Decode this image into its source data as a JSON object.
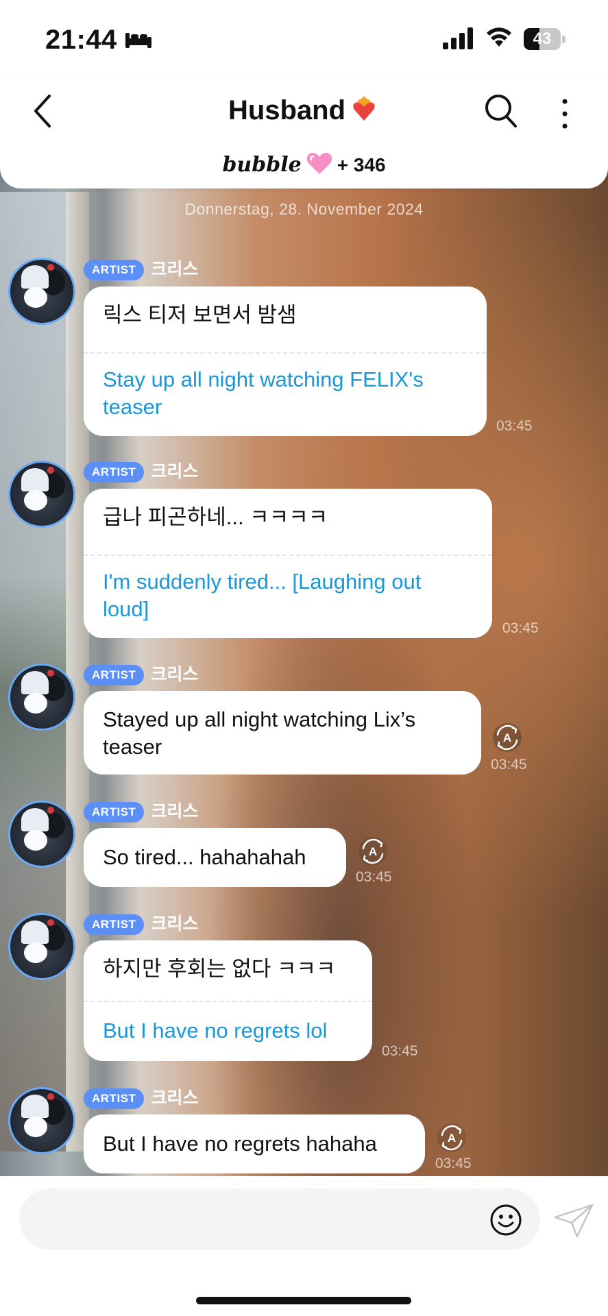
{
  "status_bar": {
    "time": "21:44",
    "battery": "43",
    "battery_level_percent": 43
  },
  "header": {
    "title": "Husband",
    "title_emoji": "heart-on-fire",
    "brand": "bubble",
    "count": "+ 346"
  },
  "chat": {
    "date": "Donnerstag, 28. November 2024",
    "messages": [
      {
        "badge": "ARTIST",
        "sender": "크리스",
        "korean": "릭스 티저 보면서 밤샘",
        "translation": "Stay up all night watching FELIX's teaser",
        "time": "03:45"
      },
      {
        "badge": "ARTIST",
        "sender": "크리스",
        "korean": "급나 피곤하네... ㅋㅋㅋㅋ",
        "translation": "I'm suddenly tired... [Laughing out loud]",
        "time": "03:45"
      },
      {
        "badge": "ARTIST",
        "sender": "크리스",
        "text": "Stayed up all night watching Lix’s teaser",
        "time": "03:45"
      },
      {
        "badge": "ARTIST",
        "sender": "크리스",
        "text": "So tired... hahahahah",
        "time": "03:45"
      },
      {
        "badge": "ARTIST",
        "sender": "크리스",
        "korean": "하지만 후회는 없다 ㅋㅋㅋ",
        "translation": "But I have no regrets lol",
        "time": "03:45"
      },
      {
        "badge": "ARTIST",
        "sender": "크리스",
        "text": "But I have no regrets hahaha",
        "time": "03:45"
      }
    ]
  },
  "input": {
    "placeholder": ""
  },
  "colors": {
    "accent": "#5b8ff5",
    "translation": "#1a97d8",
    "avatar_ring": "#6ba9f3"
  }
}
